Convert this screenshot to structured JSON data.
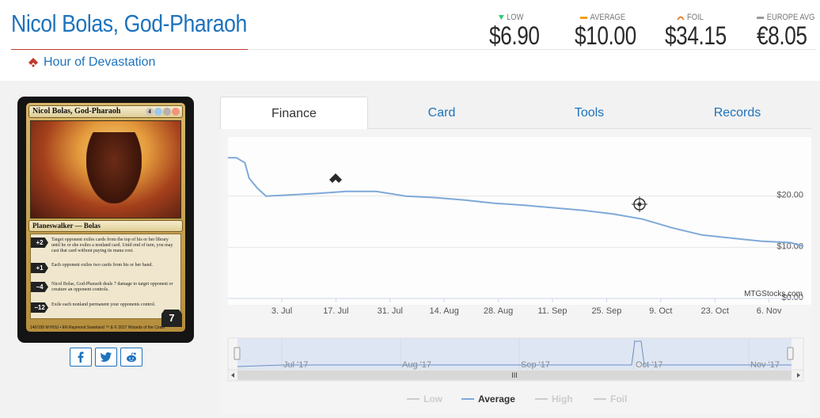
{
  "card": {
    "name": "Nicol Bolas, God-Pharaoh",
    "set_name": "Hour of Devastation",
    "image": {
      "name": "Nicol Bolas, God-Pharaoh",
      "mana_cost": [
        "4",
        "U",
        "B",
        "R"
      ],
      "type_line": "Planeswalker — Bolas",
      "abilities": [
        {
          "cost": "+2",
          "text": "Target opponent exiles cards from the top of his or her library until he or she exiles a nonland card. Until end of turn, you may cast that card without paying its mana cost."
        },
        {
          "cost": "+1",
          "text": "Each opponent exiles two cards from his or her hand."
        },
        {
          "cost": "−4",
          "text": "Nicol Bolas, God-Pharaoh deals 7 damage to target opponent or creature an opponent controls."
        },
        {
          "cost": "−12",
          "text": "Exile each nonland permanent your opponents control."
        }
      ],
      "loyalty": "7",
      "collector_line": "140/199 M",
      "set_line": "HOU • EN",
      "artist": "Raymond Swanland",
      "copyright": "™ & © 2017 Wizards of the Coast"
    }
  },
  "prices": [
    {
      "label": "LOW",
      "value": "$6.90",
      "indicator": "down-triangle",
      "color": "#2ecc71"
    },
    {
      "label": "AVERAGE",
      "value": "$10.00",
      "indicator": "bar",
      "color": "#f39c12"
    },
    {
      "label": "FOIL",
      "value": "$34.15",
      "indicator": "arc",
      "color": "#e67e22"
    },
    {
      "label": "EUROPE AVG",
      "value": "€8.05",
      "indicator": "bar",
      "color": "#999999"
    }
  ],
  "social": [
    {
      "icon": "facebook-icon"
    },
    {
      "icon": "twitter-icon"
    },
    {
      "icon": "reddit-icon"
    }
  ],
  "tabs": [
    "Finance",
    "Card",
    "Tools",
    "Records"
  ],
  "active_tab": "Finance",
  "chart_data": {
    "type": "line",
    "series": [
      {
        "name": "Average",
        "color": "#7fa9d9",
        "x": [
          "Jun 26",
          "Jun 28",
          "Jun 30",
          "Jul 1",
          "Jul 3",
          "Jul 5",
          "Jul 10",
          "Jul 17",
          "Jul 24",
          "Jul 31",
          "Aug 7",
          "Aug 14",
          "Aug 21",
          "Aug 28",
          "Sep 4",
          "Sep 11",
          "Sep 18",
          "Sep 25",
          "Oct 2",
          "Oct 9",
          "Oct 16",
          "Oct 23",
          "Oct 30",
          "Nov 6",
          "Nov 9"
        ],
        "values": [
          27.5,
          27.5,
          26.5,
          23.5,
          21.5,
          20.0,
          20.2,
          20.5,
          20.9,
          20.9,
          20.0,
          19.7,
          19.2,
          18.6,
          18.2,
          17.7,
          17.2,
          16.5,
          15.5,
          13.8,
          12.4,
          11.8,
          11.2,
          10.9,
          10.2
        ]
      }
    ],
    "legend": [
      "Low",
      "Average",
      "High",
      "Foil"
    ],
    "legend_active": "Average",
    "x_ticks": [
      "3. Jul",
      "17. Jul",
      "31. Jul",
      "14. Aug",
      "28. Aug",
      "11. Sep",
      "25. Sep",
      "9. Oct",
      "23. Oct",
      "6. Nov"
    ],
    "y_ticks": [
      "$20.00",
      "$10.00",
      "$0.00"
    ],
    "ylim": [
      0,
      30
    ],
    "watermark": "MTGStocks.com",
    "navigator_labels": [
      "Jul '17",
      "Aug '17",
      "Sep '17",
      "Oct '17",
      "Nov '17"
    ],
    "navigator_scroll_label": "III",
    "grid": true
  }
}
